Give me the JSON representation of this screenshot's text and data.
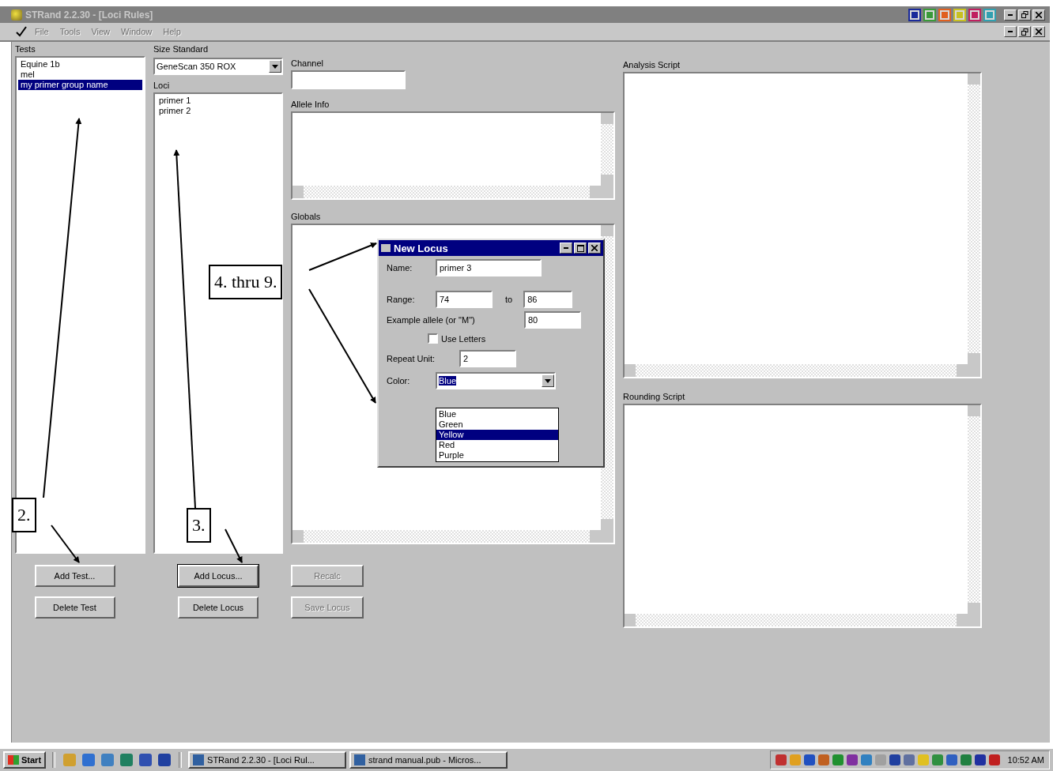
{
  "window": {
    "title": "STRand 2.2.30 - [Loci Rules]"
  },
  "menu": [
    {
      "label": "File",
      "disabled": true
    },
    {
      "label": "Tools",
      "disabled": true
    },
    {
      "label": "View",
      "disabled": true
    },
    {
      "label": "Window",
      "disabled": true
    },
    {
      "label": "Help",
      "disabled": true
    }
  ],
  "tests": {
    "label": "Tests",
    "items": [
      {
        "label": "Equine 1b",
        "selected": false
      },
      {
        "label": "mel",
        "selected": false
      },
      {
        "label": "my primer group name",
        "selected": true
      }
    ],
    "buttons": [
      {
        "label": "Add Test...",
        "disabled": false,
        "focused": false
      },
      {
        "label": "Delete Test",
        "disabled": false,
        "focused": false
      }
    ]
  },
  "size_standard": {
    "label": "Size Standard",
    "value": "GeneScan 350 ROX"
  },
  "loci": {
    "label": "Loci",
    "items": [
      {
        "label": "primer 1",
        "selected": false
      },
      {
        "label": "primer 2",
        "selected": false
      }
    ],
    "buttons": [
      {
        "label": "Add Locus...",
        "disabled": false,
        "focused": true
      },
      {
        "label": "Delete Locus",
        "disabled": false,
        "focused": false
      }
    ]
  },
  "channel": {
    "label": "Channel"
  },
  "allele_info": {
    "label": "Allele Info"
  },
  "globals": {
    "label": "Globals",
    "buttons": [
      {
        "label": "Recalc",
        "disabled": true,
        "focused": false
      },
      {
        "label": "Save Locus",
        "disabled": true,
        "focused": false
      }
    ]
  },
  "analysis_script": {
    "label": "Analysis Script"
  },
  "rounding_script": {
    "label": "Rounding Script"
  },
  "dialog": {
    "title": "New Locus",
    "name_label": "Name:",
    "name": "primer 3",
    "range_label": "Range:",
    "range_from": "74",
    "to_label": "to",
    "range_to": "86",
    "example_label": "Example allele (or \"M\")",
    "example": "80",
    "use_letters": {
      "label": "Use Letters",
      "checked": false
    },
    "repeat_label": "Repeat Unit:",
    "repeat": "2",
    "color_label": "Color:",
    "color_value": "Blue",
    "color_options": [
      {
        "label": "Blue",
        "selected": false
      },
      {
        "label": "Green",
        "selected": false
      },
      {
        "label": "Yellow",
        "selected": true
      },
      {
        "label": "Red",
        "selected": false
      },
      {
        "label": "Purple",
        "selected": false
      }
    ]
  },
  "callouts": [
    "2.",
    "3.",
    "4. thru 9."
  ],
  "taskbar": {
    "start": "Start",
    "tasks": [
      "STRand 2.2.30 - [Loci Rul...",
      "strand manual.pub - Micros..."
    ],
    "clock": "10:52 AM"
  }
}
